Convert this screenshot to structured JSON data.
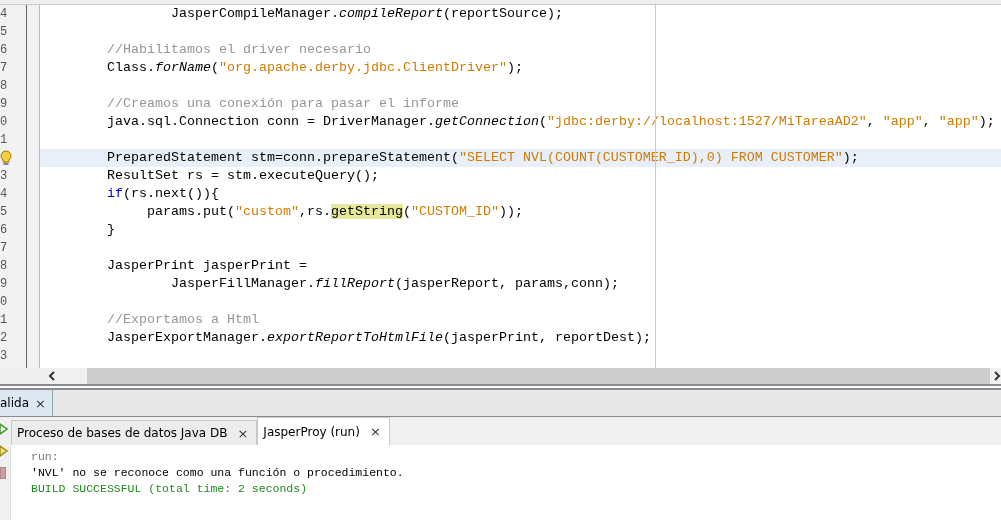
{
  "editor": {
    "lines": [
      {
        "number": "4",
        "current": false,
        "hint": false,
        "tokens": [
          {
            "kind": "plain",
            "text": "                JasperCompileManager."
          },
          {
            "kind": "method",
            "text": "compileReport"
          },
          {
            "kind": "plain",
            "text": "(reportSource);"
          }
        ]
      },
      {
        "number": "5",
        "current": false,
        "hint": false
      },
      {
        "number": "6",
        "current": false,
        "hint": false,
        "tokens": [
          {
            "kind": "comment",
            "text": "        //Habilitamos el driver necesario"
          }
        ]
      },
      {
        "number": "7",
        "current": false,
        "hint": false,
        "tokens": [
          {
            "kind": "plain",
            "text": "        Class."
          },
          {
            "kind": "method",
            "text": "forName"
          },
          {
            "kind": "plain",
            "text": "("
          },
          {
            "kind": "string",
            "text": "\"org.apache.derby.jdbc.ClientDriver\""
          },
          {
            "kind": "plain",
            "text": ");"
          }
        ]
      },
      {
        "number": "8",
        "current": false,
        "hint": false
      },
      {
        "number": "9",
        "current": false,
        "hint": false,
        "tokens": [
          {
            "kind": "comment",
            "text": "        //Creamos una conexión para pasar el informe"
          }
        ]
      },
      {
        "number": "0",
        "current": false,
        "hint": false,
        "tokens": [
          {
            "kind": "plain",
            "text": "        java.sql.Connection conn = DriverManager."
          },
          {
            "kind": "method",
            "text": "getConnection"
          },
          {
            "kind": "plain",
            "text": "("
          },
          {
            "kind": "string",
            "text": "\"jdbc:derby://localhost:1527/MiTareaAD2\""
          },
          {
            "kind": "plain",
            "text": ", "
          },
          {
            "kind": "string",
            "text": "\"app\""
          },
          {
            "kind": "plain",
            "text": ", "
          },
          {
            "kind": "string",
            "text": "\"app\""
          },
          {
            "kind": "plain",
            "text": ");"
          }
        ]
      },
      {
        "number": "1",
        "current": false,
        "hint": false
      },
      {
        "current": true,
        "hint": true,
        "tokens": [
          {
            "kind": "plain",
            "text": "        PreparedStatement stm=conn.prepareStatement("
          },
          {
            "kind": "string",
            "text": "\"SELECT NVL(COUNT(CUSTOMER_ID),0) FROM CUSTOMER\""
          },
          {
            "kind": "plain",
            "text": ");"
          }
        ]
      },
      {
        "number": "3",
        "current": false,
        "hint": false,
        "tokens": [
          {
            "kind": "plain",
            "text": "        ResultSet rs = stm.executeQuery();"
          }
        ]
      },
      {
        "number": "4",
        "current": false,
        "hint": false,
        "tokens": [
          {
            "kind": "keyword",
            "text": "        if"
          },
          {
            "kind": "plain",
            "text": "(rs.next()){"
          }
        ]
      },
      {
        "number": "5",
        "current": false,
        "hint": false,
        "tokens": [
          {
            "kind": "plain",
            "text": "             params.put("
          },
          {
            "kind": "string",
            "text": "\"custom\""
          },
          {
            "kind": "plain",
            "text": ",rs."
          },
          {
            "kind": "mark",
            "text": "getString"
          },
          {
            "kind": "plain",
            "text": "("
          },
          {
            "kind": "string",
            "text": "\"CUSTOM_ID\""
          },
          {
            "kind": "plain",
            "text": "));"
          }
        ]
      },
      {
        "number": "6",
        "current": false,
        "hint": false,
        "tokens": [
          {
            "kind": "plain",
            "text": "        }"
          }
        ]
      },
      {
        "number": "7",
        "current": false,
        "hint": false
      },
      {
        "number": "8",
        "current": false,
        "hint": false,
        "tokens": [
          {
            "kind": "plain",
            "text": "        JasperPrint jasperPrint ="
          }
        ]
      },
      {
        "number": "9",
        "current": false,
        "hint": false,
        "tokens": [
          {
            "kind": "plain",
            "text": "                JasperFillManager."
          },
          {
            "kind": "method",
            "text": "fillReport"
          },
          {
            "kind": "plain",
            "text": "(jasperReport, params,conn);"
          }
        ]
      },
      {
        "number": "0",
        "current": false,
        "hint": false
      },
      {
        "number": "1",
        "current": false,
        "hint": false,
        "tokens": [
          {
            "kind": "comment",
            "text": "        //Exportamos a Html"
          }
        ]
      },
      {
        "number": "2",
        "current": false,
        "hint": false,
        "tokens": [
          {
            "kind": "plain",
            "text": "        JasperExportManager."
          },
          {
            "kind": "method",
            "text": "exportReportToHtmlFile"
          },
          {
            "kind": "plain",
            "text": "(jasperPrint, reportDest);"
          }
        ]
      },
      {
        "number": "3",
        "current": false,
        "hint": false
      }
    ]
  },
  "output_window": {
    "tab": {
      "label": "alida",
      "close": "×"
    },
    "tabs": [
      {
        "label": "Proceso de bases de datos Java DB",
        "close": "×",
        "selected": false
      },
      {
        "label": "JasperProy (run)",
        "close": "×",
        "selected": true
      }
    ],
    "lines": [
      {
        "kind": "muted",
        "text": "run:"
      },
      {
        "kind": "plain",
        "text": "'NVL' no se reconoce como una función o procedimiento."
      },
      {
        "kind": "success",
        "text": "BUILD SUCCESSFUL (total time: 2 seconds)"
      }
    ]
  }
}
